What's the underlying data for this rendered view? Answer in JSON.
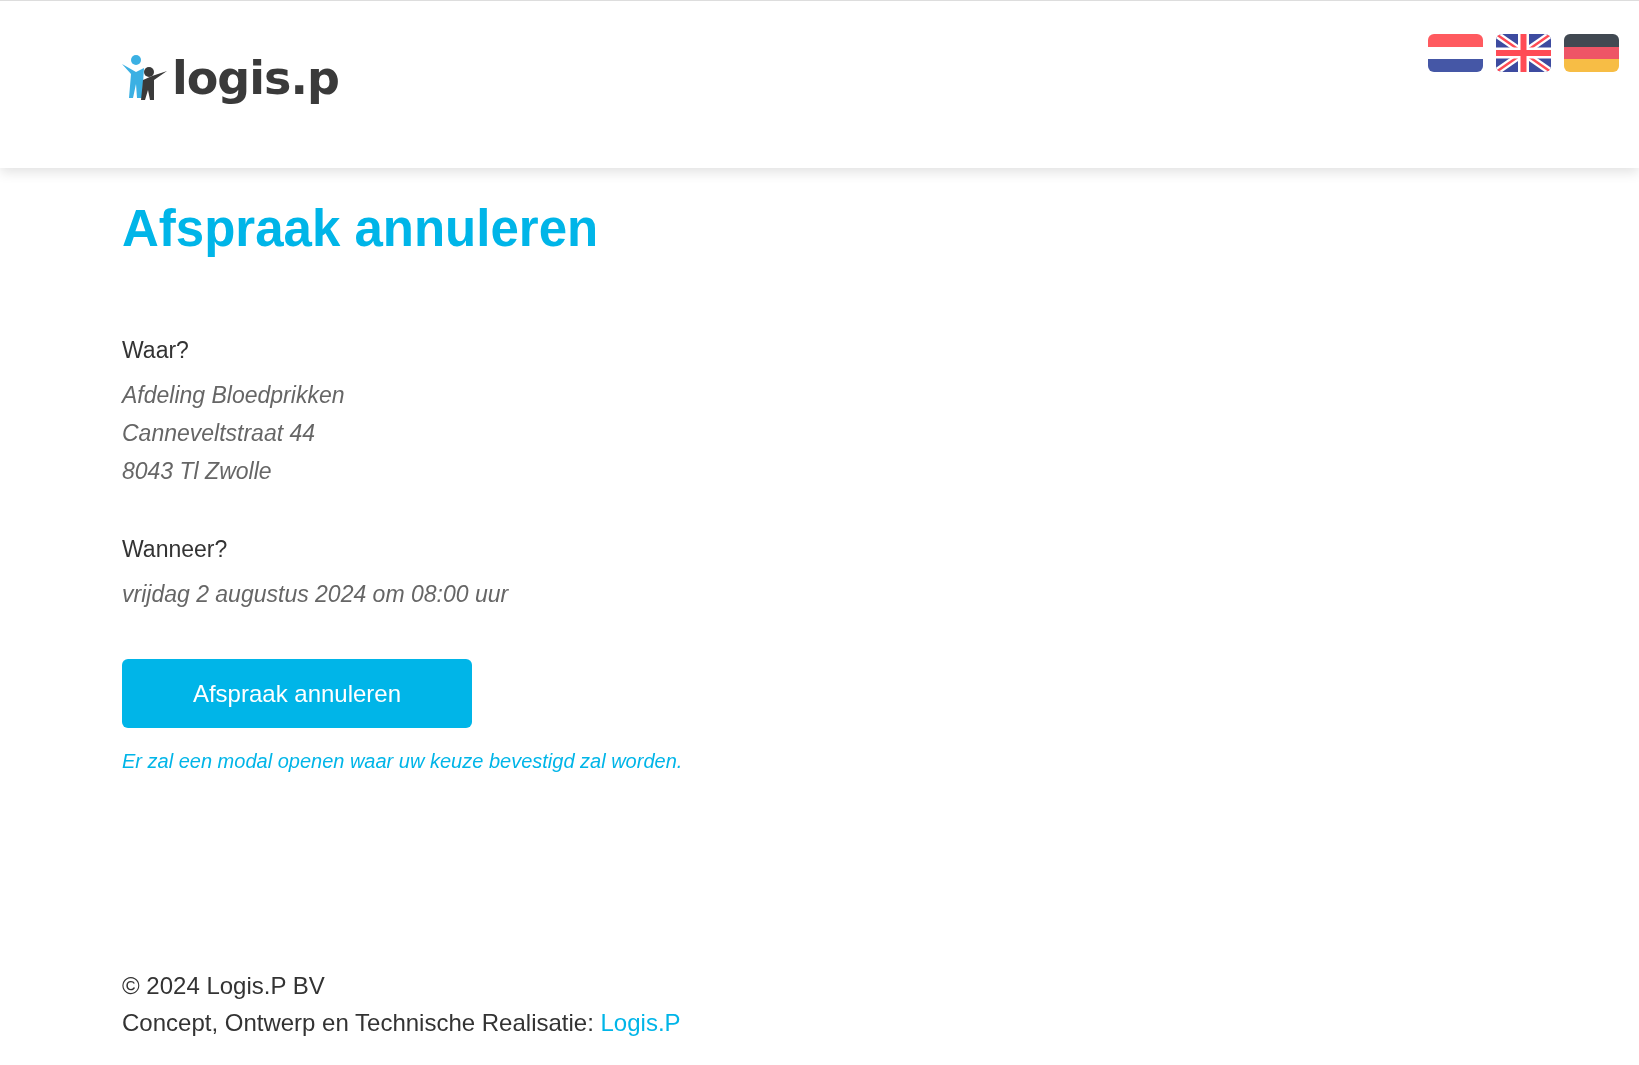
{
  "header": {
    "logo_text": "logis.p",
    "languages": [
      {
        "kind": "nl"
      },
      {
        "kind": "en"
      },
      {
        "kind": "de"
      }
    ]
  },
  "title": "Afspraak annuleren",
  "sections": [
    {
      "label": "Waar?",
      "lines": [
        "Afdeling Bloedprikken",
        "Canneveltstraat 44",
        "8043 Tl Zwolle"
      ]
    },
    {
      "label": "Wanneer?",
      "lines": [
        "vrijdag 2 augustus 2024 om 08:00 uur"
      ]
    }
  ],
  "button": "Afspraak annuleren",
  "note": "Er zal een modal openen waar uw keuze bevestigd zal worden.",
  "footer": {
    "copyright": "© 2024 Logis.P BV",
    "credit": "Concept, Ontwerp en Technische Realisatie:",
    "link": "Logis.P"
  }
}
